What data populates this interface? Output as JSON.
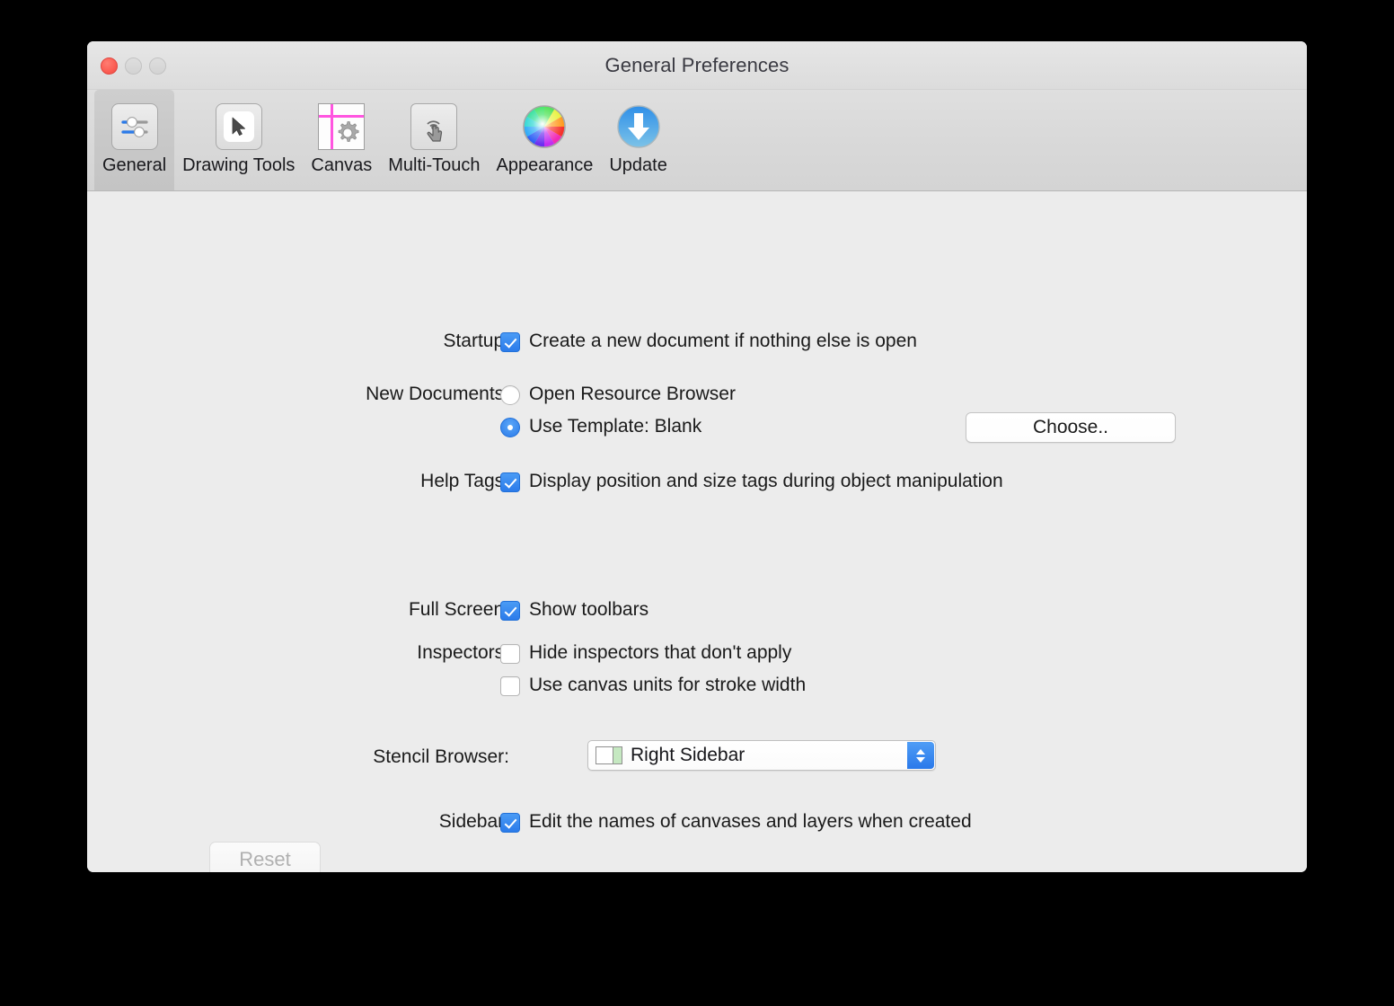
{
  "window": {
    "title": "General Preferences",
    "controls": {
      "close": "close-button",
      "minimize": "minimize-button",
      "zoom": "zoom-button"
    }
  },
  "toolbar": {
    "tabs": [
      {
        "label": "General",
        "icon": "sliders-icon",
        "selected": true
      },
      {
        "label": "Drawing Tools",
        "icon": "cursor-arrow-icon",
        "selected": false
      },
      {
        "label": "Canvas",
        "icon": "canvas-gear-icon",
        "selected": false
      },
      {
        "label": "Multi-Touch",
        "icon": "touch-hand-icon",
        "selected": false
      },
      {
        "label": "Appearance",
        "icon": "color-wheel-icon",
        "selected": false
      },
      {
        "label": "Update",
        "icon": "download-arrow-icon",
        "selected": false
      }
    ]
  },
  "form": {
    "startup": {
      "label": "Startup:",
      "checkbox": {
        "text": "Create a new document if nothing else is open",
        "checked": true
      }
    },
    "new_documents": {
      "label": "New Documents:",
      "options": [
        {
          "text": "Open Resource Browser",
          "selected": false
        },
        {
          "text": "Use Template: Blank",
          "selected": true
        }
      ],
      "choose_button": "Choose.."
    },
    "help_tags": {
      "label": "Help Tags:",
      "checkbox": {
        "text": "Display position and size tags during object manipulation",
        "checked": true
      }
    },
    "full_screen": {
      "label": "Full Screen:",
      "checkbox": {
        "text": "Show toolbars",
        "checked": true
      }
    },
    "inspectors": {
      "label": "Inspectors:",
      "checkboxes": [
        {
          "text": "Hide inspectors that don't apply",
          "checked": false
        },
        {
          "text": "Use canvas units for stroke width",
          "checked": false
        }
      ]
    },
    "stencil_browser": {
      "label": "Stencil Browser:",
      "value": "Right Sidebar",
      "icon": "right-sidebar-icon"
    },
    "sidebar": {
      "label": "Sidebar:",
      "checkbox": {
        "text": "Edit the names of canvases and layers when created",
        "checked": true
      }
    }
  },
  "footer": {
    "reset_button": "Reset",
    "reset_enabled": false,
    "help_button": "?"
  },
  "colors": {
    "accent_blue": "#2b7bea",
    "window_bg": "#ececec",
    "toolbar_bg": "#d9d9d9",
    "close_red": "#fc5f55",
    "help_blue": "#1782e8",
    "sidebar_green": "#c5e8c1"
  }
}
